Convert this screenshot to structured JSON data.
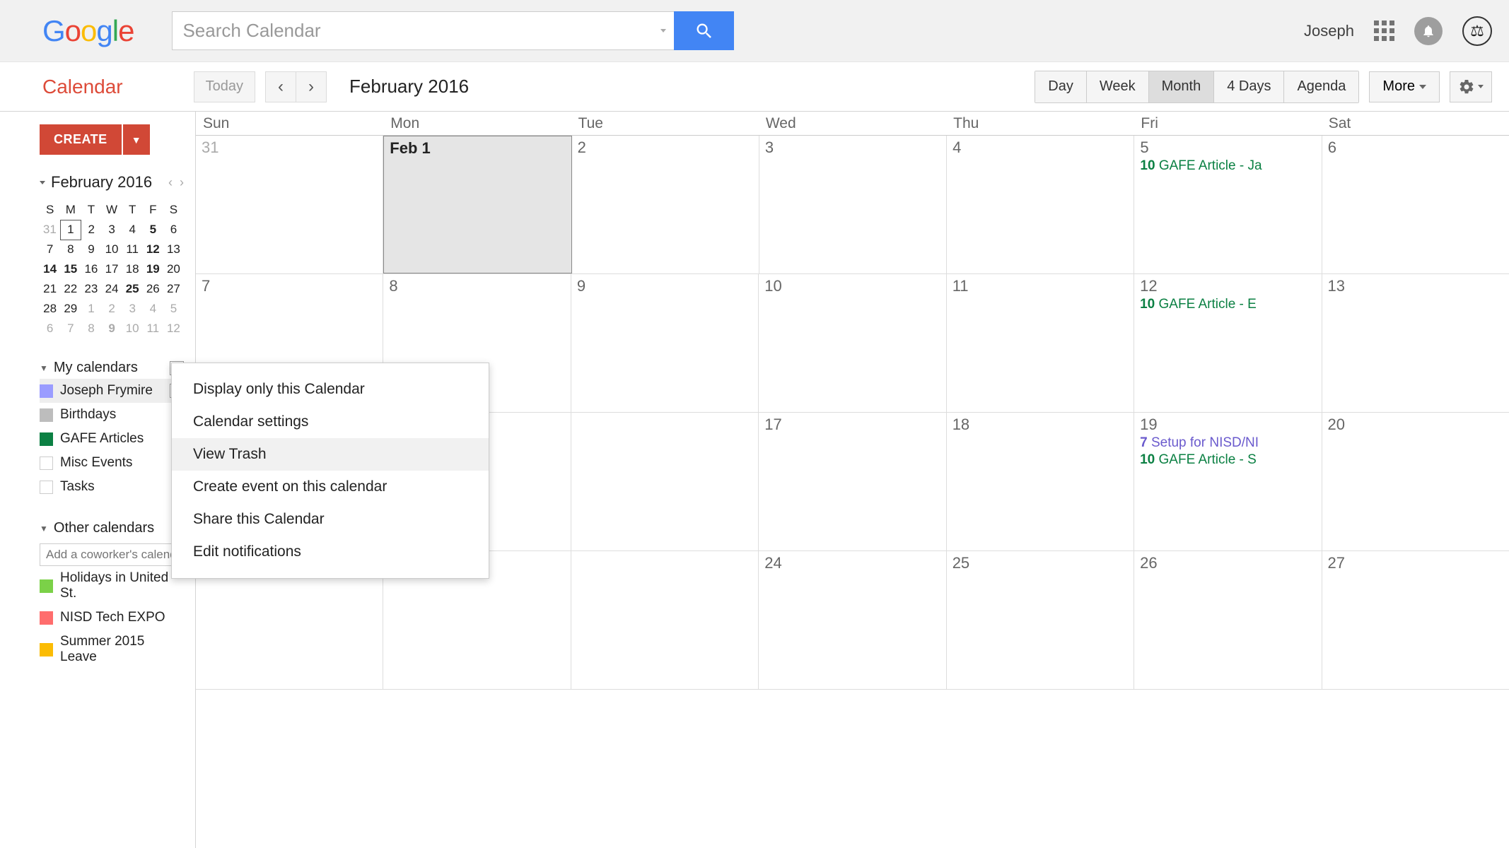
{
  "logo": {
    "g1": "G",
    "o1": "o",
    "o2": "o",
    "g2": "g",
    "l": "l",
    "e": "e"
  },
  "search_placeholder": "Search Calendar",
  "user_name": "Joseph",
  "app_title": "Calendar",
  "today_label": "Today",
  "month_label": "February 2016",
  "views": [
    "Day",
    "Week",
    "Month",
    "4 Days",
    "Agenda"
  ],
  "active_view": "Month",
  "more_label": "More",
  "create_label": "CREATE",
  "mini_title": "February 2016",
  "mini_dow": [
    "S",
    "M",
    "T",
    "W",
    "T",
    "F",
    "S"
  ],
  "mini_weeks": [
    [
      {
        "n": 31,
        "o": true
      },
      {
        "n": 1,
        "sel": true
      },
      {
        "n": 2
      },
      {
        "n": 3
      },
      {
        "n": 4
      },
      {
        "n": 5,
        "b": true
      },
      {
        "n": 6
      }
    ],
    [
      {
        "n": 7
      },
      {
        "n": 8
      },
      {
        "n": 9
      },
      {
        "n": 10
      },
      {
        "n": 11
      },
      {
        "n": 12,
        "b": true
      },
      {
        "n": 13
      }
    ],
    [
      {
        "n": 14,
        "b": true
      },
      {
        "n": 15,
        "b": true
      },
      {
        "n": 16
      },
      {
        "n": 17
      },
      {
        "n": 18
      },
      {
        "n": 19,
        "b": true
      },
      {
        "n": 20
      }
    ],
    [
      {
        "n": 21
      },
      {
        "n": 22
      },
      {
        "n": 23
      },
      {
        "n": 24
      },
      {
        "n": 25,
        "b": true
      },
      {
        "n": 26
      },
      {
        "n": 27
      }
    ],
    [
      {
        "n": 28
      },
      {
        "n": 29
      },
      {
        "n": 1,
        "o": true
      },
      {
        "n": 2,
        "o": true
      },
      {
        "n": 3,
        "o": true
      },
      {
        "n": 4,
        "o": true
      },
      {
        "n": 5,
        "o": true
      }
    ],
    [
      {
        "n": 6,
        "o": true
      },
      {
        "n": 7,
        "o": true
      },
      {
        "n": 8,
        "o": true
      },
      {
        "n": 9,
        "o": true,
        "b": true
      },
      {
        "n": 10,
        "o": true
      },
      {
        "n": 11,
        "o": true
      },
      {
        "n": 12,
        "o": true
      }
    ]
  ],
  "my_calendars_label": "My calendars",
  "my_calendars": [
    {
      "name": "Joseph Frymire",
      "color": "#9a9cff",
      "highlighted": true,
      "dd": true
    },
    {
      "name": "Birthdays",
      "color": "#bdbdbd"
    },
    {
      "name": "GAFE Articles",
      "color": "#0b8043"
    },
    {
      "name": "Misc Events",
      "color": "#ffffff",
      "border": true
    },
    {
      "name": "Tasks",
      "color": "#ffffff",
      "border": true
    }
  ],
  "other_calendars_label": "Other calendars",
  "coworker_placeholder": "Add a coworker's calenda",
  "other_calendars": [
    {
      "name": "Holidays in United St.",
      "color": "#7bd148"
    },
    {
      "name": "NISD Tech EXPO",
      "color": "#ff6d6d"
    },
    {
      "name": "Summer 2015 Leave",
      "color": "#fbbc04"
    }
  ],
  "ctx_menu": [
    "Display only this Calendar",
    "Calendar settings",
    "View Trash",
    "Create event on this calendar",
    "Share this Calendar",
    "Edit notifications"
  ],
  "ctx_hover_index": 2,
  "dow": [
    "Sun",
    "Mon",
    "Tue",
    "Wed",
    "Thu",
    "Fri",
    "Sat"
  ],
  "grid": [
    [
      {
        "label": "31",
        "prev": true
      },
      {
        "label": "Feb 1",
        "selected": true
      },
      {
        "label": "2"
      },
      {
        "label": "3"
      },
      {
        "label": "4"
      },
      {
        "label": "5",
        "events": [
          {
            "time": "10",
            "text": "GAFE Article - Ja",
            "cls": "green"
          }
        ]
      },
      {
        "label": "6"
      }
    ],
    [
      {
        "label": "7"
      },
      {
        "label": "8"
      },
      {
        "label": "9"
      },
      {
        "label": "10"
      },
      {
        "label": "11"
      },
      {
        "label": "12",
        "events": [
          {
            "time": "10",
            "text": "GAFE Article - E",
            "cls": "green"
          }
        ]
      },
      {
        "label": "13"
      }
    ],
    [
      {
        "label": ""
      },
      {
        "label": ""
      },
      {
        "label": ""
      },
      {
        "label": "17"
      },
      {
        "label": "18"
      },
      {
        "label": "19",
        "events": [
          {
            "time": "7",
            "text": "Setup for NISD/NI",
            "cls": "purple"
          },
          {
            "time": "10",
            "text": "GAFE Article - S",
            "cls": "green"
          }
        ]
      },
      {
        "label": "20"
      }
    ],
    [
      {
        "label": ""
      },
      {
        "label": ""
      },
      {
        "label": ""
      },
      {
        "label": "24"
      },
      {
        "label": "25"
      },
      {
        "label": "26"
      },
      {
        "label": "27"
      }
    ]
  ]
}
